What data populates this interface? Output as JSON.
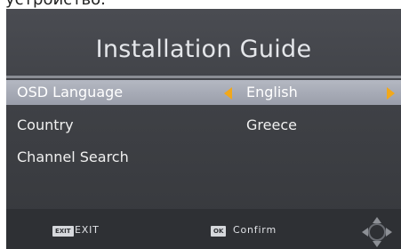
{
  "header_caption": "устройство.",
  "title": "Installation Guide",
  "menu": [
    {
      "label": "OSD Language",
      "value": "English",
      "selected": true
    },
    {
      "label": "Country",
      "value": "Greece",
      "selected": false
    },
    {
      "label": "Channel Search",
      "value": "",
      "selected": false
    }
  ],
  "footer": {
    "exit_key": "EXIT",
    "exit_label": "EXIT",
    "ok_key": "OK",
    "ok_label": "Confirm"
  },
  "icons": {
    "left_arrow": "caret-left-icon",
    "right_arrow": "caret-right-icon",
    "nav_pad": "dpad-icon"
  },
  "colors": {
    "accent_arrow": "#f1a81b",
    "selected_row": "#a6aab5",
    "background": "#3f4146"
  }
}
